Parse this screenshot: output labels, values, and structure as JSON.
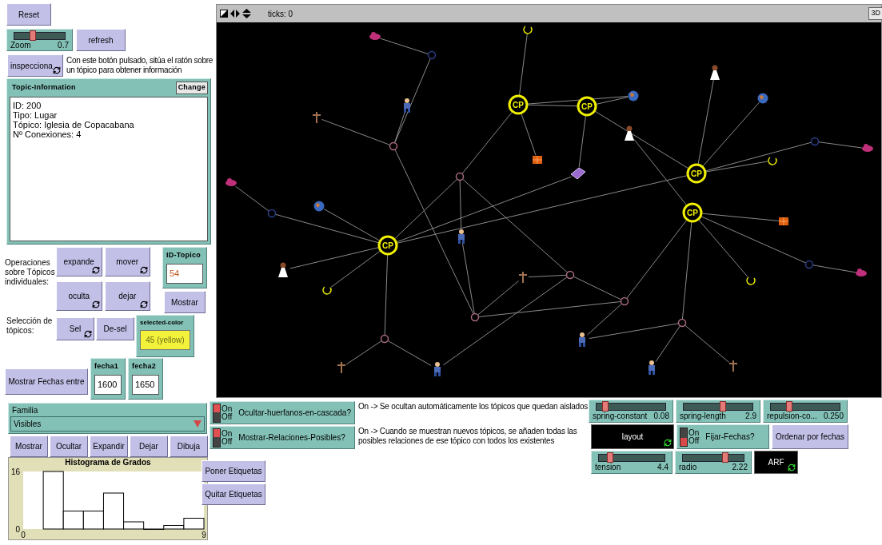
{
  "reset": {
    "label": "Reset",
    "forever": false
  },
  "zoom": {
    "name": "Zoom",
    "value": "0.7",
    "level": 0.35
  },
  "refresh": {
    "label": "refresh",
    "forever": false
  },
  "inspect": {
    "label": "inspecciona",
    "forever": true
  },
  "inspect_note": "Con este botón pulsado, sitúa el ratón sobre un tópico para obtener información",
  "topic_info": {
    "title": "Topic-Information",
    "change": "Change",
    "lines": [
      "ID: 200",
      "Tipo: Lugar",
      "Tópico: Iglesia de Copacabana",
      "Nº Conexiones: 4"
    ]
  },
  "operations_label": "Operaciones sobre Tópicos individuales:",
  "operations": [
    {
      "label": "expande",
      "forever": true
    },
    {
      "label": "mover",
      "forever": true
    },
    {
      "label": "oculta",
      "forever": true
    },
    {
      "label": "dejar",
      "forever": true
    }
  ],
  "id_topico": {
    "title": "ID-Topico",
    "value": "54"
  },
  "mostrar": {
    "label": "Mostrar",
    "forever": false
  },
  "selection_label": "Selección de tópicos:",
  "selection": [
    {
      "label": "Sel",
      "forever": true
    },
    {
      "label": "De-sel",
      "forever": false
    }
  ],
  "selected_color": {
    "title": "selected-color",
    "value": "45 (yellow)",
    "color": "#f2f23a"
  },
  "fechas_button": {
    "label": "Mostrar Fechas entre",
    "forever": false
  },
  "fechas": [
    {
      "title": "fecha1",
      "value": "1600"
    },
    {
      "title": "fecha2",
      "value": "1650"
    }
  ],
  "view": {
    "ticks": "ticks: 0",
    "three_d": "3D",
    "hubs": [
      {
        "label": "CP"
      },
      {
        "label": "CP"
      },
      {
        "label": "CP"
      },
      {
        "label": "CP"
      },
      {
        "label": "CP"
      }
    ]
  },
  "familia": {
    "label": "Familia",
    "value": "Visibles"
  },
  "familia_buttons": [
    {
      "label": "Mostrar",
      "forever": false
    },
    {
      "label": "Ocultar",
      "forever": false
    },
    {
      "label": "Expandir",
      "forever": false
    },
    {
      "label": "Dejar",
      "forever": false
    },
    {
      "label": "Dibuja",
      "forever": false
    }
  ],
  "histogram": {
    "chart_data": {
      "type": "bar",
      "title": "Histograma de Grados",
      "x": [
        1.5,
        2.5,
        3.5,
        4.5,
        5.5,
        6.5,
        7.5,
        8.5
      ],
      "values": [
        16,
        5,
        5,
        10,
        2,
        0,
        1,
        3
      ],
      "xlim": [
        0,
        9
      ],
      "ylim": [
        0,
        16
      ],
      "xticks": [
        {
          "value": 0,
          "label": "0"
        },
        {
          "value": 9,
          "label": "9"
        }
      ],
      "yticks": [
        {
          "value": 0,
          "label": "0"
        },
        {
          "value": 16,
          "label": "16"
        }
      ]
    }
  },
  "label_buttons": [
    {
      "label": "Poner Etiquetas",
      "forever": false
    },
    {
      "label": "Quitar Etiquetas",
      "forever": false
    }
  ],
  "switches": [
    {
      "label": "Ocultar-huerfanos-en-cascada?",
      "on_text": "On",
      "off_text": "Off",
      "on": true,
      "note": "On -> Se ocultan automáticamente los tópicos que quedan aislados"
    },
    {
      "label": "Mostrar-Relaciones-Posibles?",
      "on_text": "On",
      "off_text": "Off",
      "on": true,
      "note": "On -> Cuando se muestran nuevos tópicos, se añaden todas las posibles relaciones de ese tópico con todos los existentes"
    }
  ],
  "sliders_top": [
    {
      "name": "spring-constant",
      "value": "0.08",
      "level": 0.1
    },
    {
      "name": "spring-length",
      "value": "2.9",
      "level": 0.57
    },
    {
      "name": "repulsion-co...",
      "value": "0.250",
      "level": 0.25
    }
  ],
  "layout_button": {
    "label": "layout",
    "forever": true
  },
  "fijar": {
    "label": "Fijar-Fechas?",
    "on_text": "On",
    "off_text": "Off",
    "on": false
  },
  "ordenar": {
    "label": "Ordenar por fechas",
    "forever": false
  },
  "sliders_bottom": [
    {
      "name": "tension",
      "value": "4.4",
      "level": 0.15
    },
    {
      "name": "radio",
      "value": "2.22",
      "level": 0.72
    }
  ],
  "arf_button": {
    "label": "ARF",
    "forever": true
  }
}
